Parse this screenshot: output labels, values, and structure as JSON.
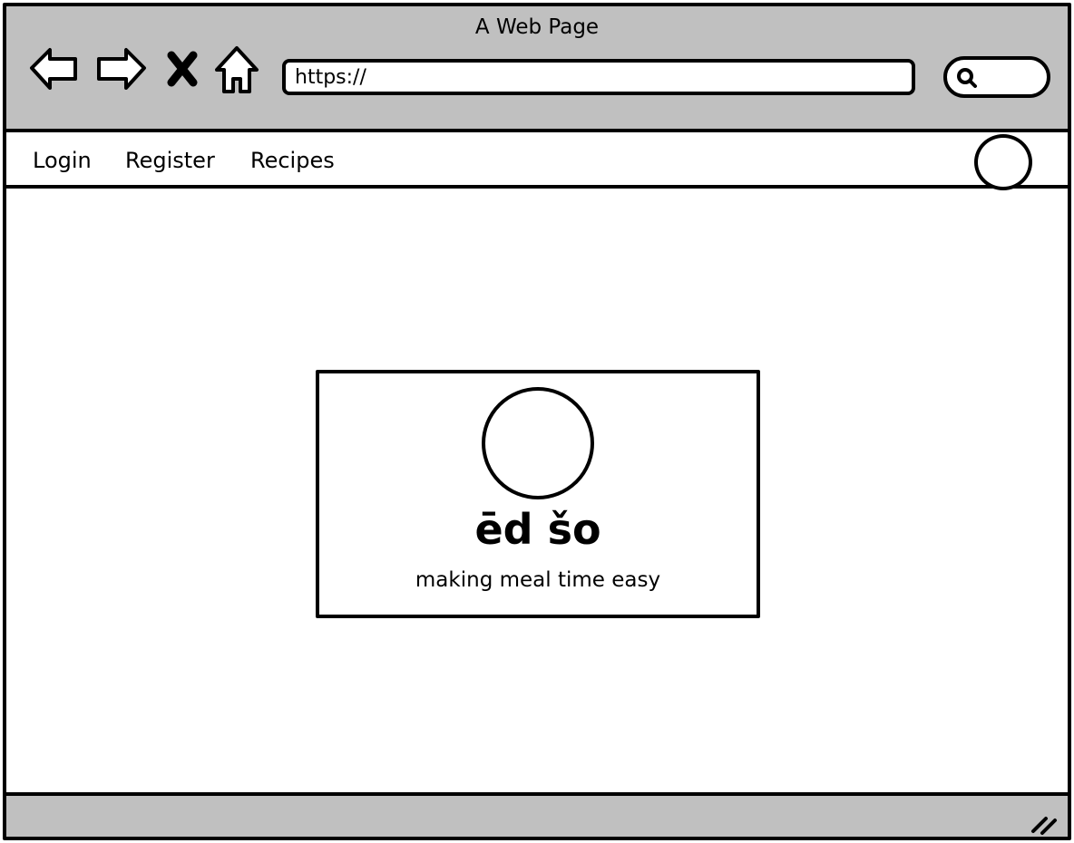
{
  "window": {
    "title": "A Web Page"
  },
  "toolbar": {
    "back_icon": "back-arrow-icon",
    "forward_icon": "forward-arrow-icon",
    "stop_icon": "close-icon",
    "home_icon": "home-icon",
    "url_value": "https://",
    "search_icon": "search-icon"
  },
  "site_nav": {
    "items": [
      {
        "label": "Login"
      },
      {
        "label": "Register"
      },
      {
        "label": "Recipes"
      }
    ]
  },
  "hero": {
    "brand": "ēd šo",
    "tagline": "making meal time easy"
  },
  "colors": {
    "chrome": "#c0c0c0",
    "stroke": "#000000",
    "background": "#ffffff"
  }
}
